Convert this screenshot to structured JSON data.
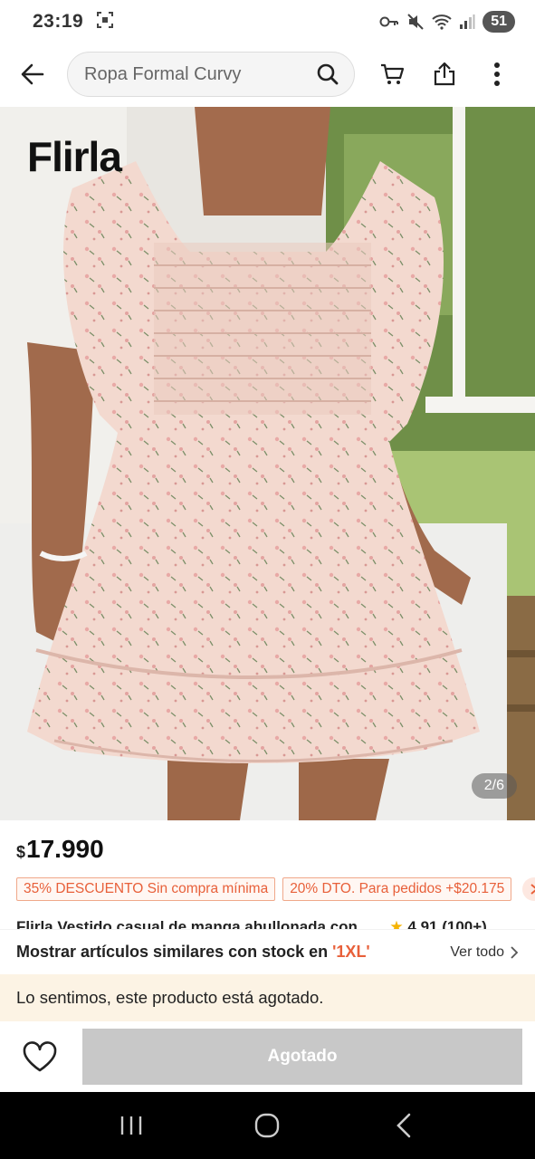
{
  "status": {
    "time": "23:19",
    "battery": "51"
  },
  "header": {
    "search_placeholder": "Ropa Formal Curvy",
    "icons": [
      "back-arrow-icon",
      "search-icon",
      "cart-icon",
      "share-icon",
      "more-vertical-icon"
    ]
  },
  "product": {
    "brand_logo": "Flirla",
    "image_counter": "2/6",
    "currency": "$",
    "price": "17.990",
    "coupons": [
      "35% DESCUENTO Sin compra mínima",
      "20% DTO. Para pedidos +$20.175"
    ],
    "title_partial": "Flirla Vestido casual de manga abullonada con",
    "rating": "4.91",
    "rating_count": "(100+)"
  },
  "similar": {
    "label": "Mostrar artículos similares con stock en ",
    "size": "'1XL'",
    "view_all": "Ver todo"
  },
  "notice": {
    "text": "Lo sentimos, este producto está agotado."
  },
  "actions": {
    "sold_out": "Agotado"
  },
  "colors": {
    "accent": "#e8603a",
    "notice_bg": "#fcf3e4",
    "disabled_button": "#c8c8c8"
  }
}
